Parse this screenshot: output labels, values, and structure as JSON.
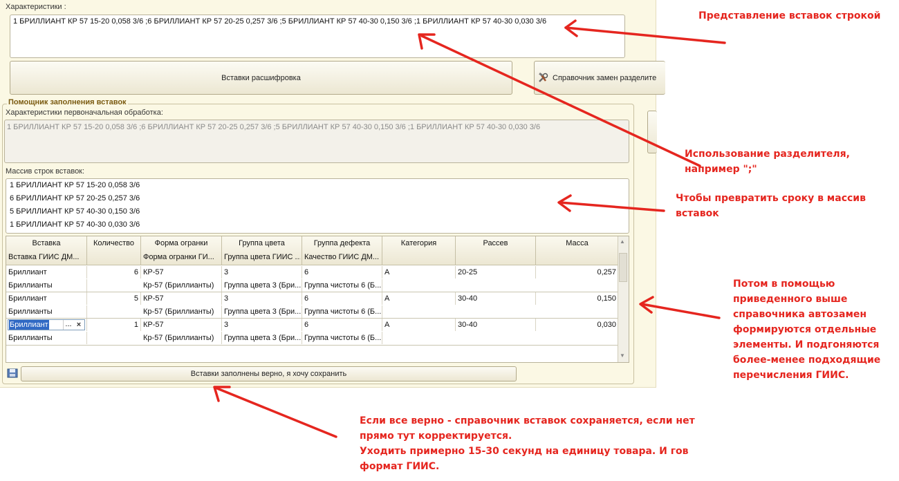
{
  "form": {
    "characteristics_label": "Характеристики :",
    "characteristics_value": "1 БРИЛЛИАНТ КР 57 15-20 0,058 3/6 ;6 БРИЛЛИАНТ КР 57 20-25 0,257 3/6 ;5 БРИЛЛИАНТ КР 57 40-30 0,150 3/6 ;1 БРИЛЛИАНТ КР 57 40-30 0,030 3/6",
    "decode_button": "Вставки расшифровка",
    "replacements_button": "Справочник замен разделите",
    "helper_group_title": "Помощник заполнения вставок",
    "initial_label": "Характеристики первоначальная обработка:",
    "initial_value": "1 БРИЛЛИАНТ КР 57 15-20 0,058 3/6 ;6 БРИЛЛИАНТ КР 57 20-25 0,257 3/6 ;5 БРИЛЛИАНТ КР 57 40-30 0,150 3/6 ;1 БРИЛЛИАНТ КР 57 40-30 0,030 3/6",
    "array_label": "Массив строк вставок:",
    "array_lines": [
      "1 БРИЛЛИАНТ КР 57 15-20 0,058 3/6",
      "6 БРИЛЛИАНТ КР 57 20-25 0,257 3/6",
      "5 БРИЛЛИАНТ КР 57 40-30 0,150 3/6",
      "1 БРИЛЛИАНТ КР 57 40-30 0,030 3/6"
    ],
    "save_button": "Вставки заполнены верно, я хочу сохранить"
  },
  "table": {
    "headers": [
      {
        "top": "Вставка",
        "bottom": "Вставка ГИИС ДМ..."
      },
      {
        "top": "Количество",
        "bottom": ""
      },
      {
        "top": "Форма огранки",
        "bottom": "Форма огранки ГИ..."
      },
      {
        "top": "Группа цвета",
        "bottom": "Группа цвета ГИИС ..."
      },
      {
        "top": "Группа дефекта",
        "bottom": "Качество ГИИС ДМ..."
      },
      {
        "top": "Категория",
        "bottom": ""
      },
      {
        "top": "Рассев",
        "bottom": ""
      },
      {
        "top": "Масса",
        "bottom": ""
      }
    ],
    "rows": [
      {
        "insert": "Бриллиант",
        "insert_giis": "Бриллианты",
        "qty": "6",
        "cut": "КР-57",
        "cut_giis": "Кр-57 (Бриллианты)",
        "color": "3",
        "color_giis": "Группа цвета 3 (Бри...",
        "defect": "6",
        "quality_giis": "Группа чистоты 6 (Б...",
        "category": "А",
        "sieve": "20-25",
        "mass": "0,257"
      },
      {
        "insert": "Бриллиант",
        "insert_giis": "Бриллианты",
        "qty": "5",
        "cut": "КР-57",
        "cut_giis": "Кр-57 (Бриллианты)",
        "color": "3",
        "color_giis": "Группа цвета 3 (Бри...",
        "defect": "6",
        "quality_giis": "Группа чистоты 6 (Б...",
        "category": "А",
        "sieve": "30-40",
        "mass": "0,150"
      },
      {
        "insert": "Бриллиант",
        "insert_giis": "Бриллианты",
        "qty": "1",
        "cut": "КР-57",
        "cut_giis": "Кр-57 (Бриллианты)",
        "color": "3",
        "color_giis": "Группа цвета 3 (Бри...",
        "defect": "6",
        "quality_giis": "Группа чистоты 6 (Б...",
        "category": "А",
        "sieve": "30-40",
        "mass": "0,030"
      }
    ],
    "ellipsis": "...",
    "clear": "×"
  },
  "annotations": {
    "string_repr": "Представление вставок строкой",
    "separator": [
      "Использование разделителя,",
      "например \";\""
    ],
    "array": [
      "Чтобы превратить сроку в массив",
      "вставок"
    ],
    "replace": [
      "Потом в помощью",
      "приведенного выше",
      "справочника автозамен",
      "формируются отдельные",
      "элементы. И подгоняются",
      "более-менее подходящие",
      "перечисления ГИИС."
    ],
    "save": [
      "Если все верно - справочник вставок сохраняется, если нет",
      "прямо тут корректируется.",
      "Уходить примерно 15-30 секунд на единицу товара. И гов",
      "формат ГИИС."
    ]
  },
  "colors": {
    "annotation": "#e5261f",
    "form_bg": "#fbf8e4",
    "group_title": "#7a5a10"
  }
}
